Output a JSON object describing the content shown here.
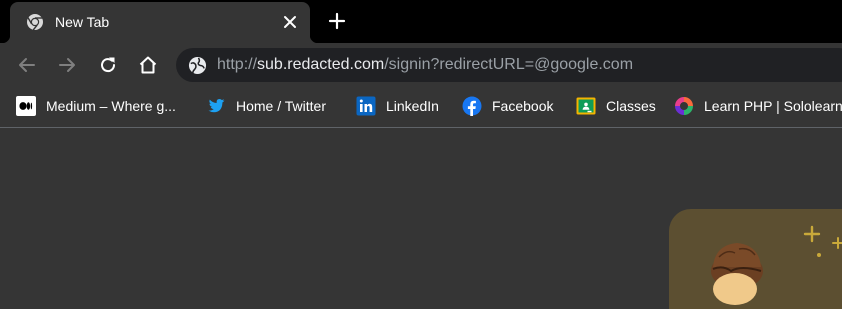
{
  "tab": {
    "title": "New Tab",
    "favicon": "chrome-icon",
    "close_icon": "close-icon"
  },
  "new_tab_icon": "plus-icon",
  "toolbar": {
    "back_icon": "back-arrow-icon",
    "forward_icon": "forward-arrow-icon",
    "reload_icon": "reload-icon",
    "home_icon": "home-icon"
  },
  "omnibox": {
    "security_icon": "globe-icon",
    "url_scheme": "http://",
    "url_host": "sub.redacted.com",
    "url_path": "/signin?redirectURL=@google.com"
  },
  "bookmarks": [
    {
      "label": "Medium – Where g...",
      "icon": "medium-icon"
    },
    {
      "label": "Home / Twitter",
      "icon": "twitter-icon"
    },
    {
      "label": "LinkedIn",
      "icon": "linkedin-icon"
    },
    {
      "label": "Facebook",
      "icon": "facebook-icon"
    },
    {
      "label": "Classes",
      "icon": "google-classroom-icon"
    },
    {
      "label": "Learn PHP | Sololearn",
      "icon": "sololearn-icon"
    }
  ],
  "colors": {
    "frame": "#000000",
    "toolbar": "#353535",
    "omnibox": "#202124",
    "url_dim": "#9aa0a6",
    "url_host": "#e8eaed",
    "twitter": "#1da1f2",
    "linkedin": "#0a66c2",
    "facebook": "#1877f2",
    "classroom": "#f4b400",
    "doodle_bg": "#5c4f31"
  }
}
